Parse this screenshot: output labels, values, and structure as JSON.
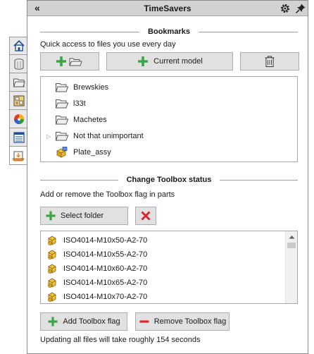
{
  "panel": {
    "title": "TimeSavers",
    "collapse_glyph": "«"
  },
  "side_tabs": [
    {
      "icon": "home-icon"
    },
    {
      "icon": "cylinder-part-icon"
    },
    {
      "icon": "folder-icon"
    },
    {
      "icon": "drawing-icon"
    },
    {
      "icon": "appearance-icon"
    },
    {
      "icon": "properties-list-icon"
    },
    {
      "icon": "toolbox-icon"
    }
  ],
  "bookmarks": {
    "header": "Bookmarks",
    "description": "Quick access to files you use every day",
    "current_model_label": "Current model",
    "items": [
      {
        "label": "Brewskies",
        "icon": "folder-icon",
        "expandable": false
      },
      {
        "label": "l33t",
        "icon": "folder-icon",
        "expandable": false
      },
      {
        "label": "Machetes",
        "icon": "folder-icon",
        "expandable": false
      },
      {
        "label": "Not that unimportant",
        "icon": "folder-icon",
        "expandable": true
      },
      {
        "label": "Plate_assy",
        "icon": "assembly-icon",
        "expandable": false
      }
    ]
  },
  "toolbox": {
    "header": "Change Toolbox status",
    "description": "Add or remove the Toolbox flag in parts",
    "select_folder_label": "Select folder",
    "files": [
      {
        "label": "ISO4014-M10x50-A2-70"
      },
      {
        "label": "ISO4014-M10x55-A2-70"
      },
      {
        "label": "ISO4014-M10x60-A2-70"
      },
      {
        "label": "ISO4014-M10x65-A2-70"
      },
      {
        "label": "ISO4014-M10x70-A2-70"
      }
    ],
    "add_label": "Add Toolbox flag",
    "remove_label": "Remove Toolbox flag",
    "status": "Updating all files will take roughly 154 seconds"
  },
  "colors": {
    "accent_rule": "#e48a3c",
    "add_green": "#3aa642",
    "remove_red": "#d9262a"
  }
}
